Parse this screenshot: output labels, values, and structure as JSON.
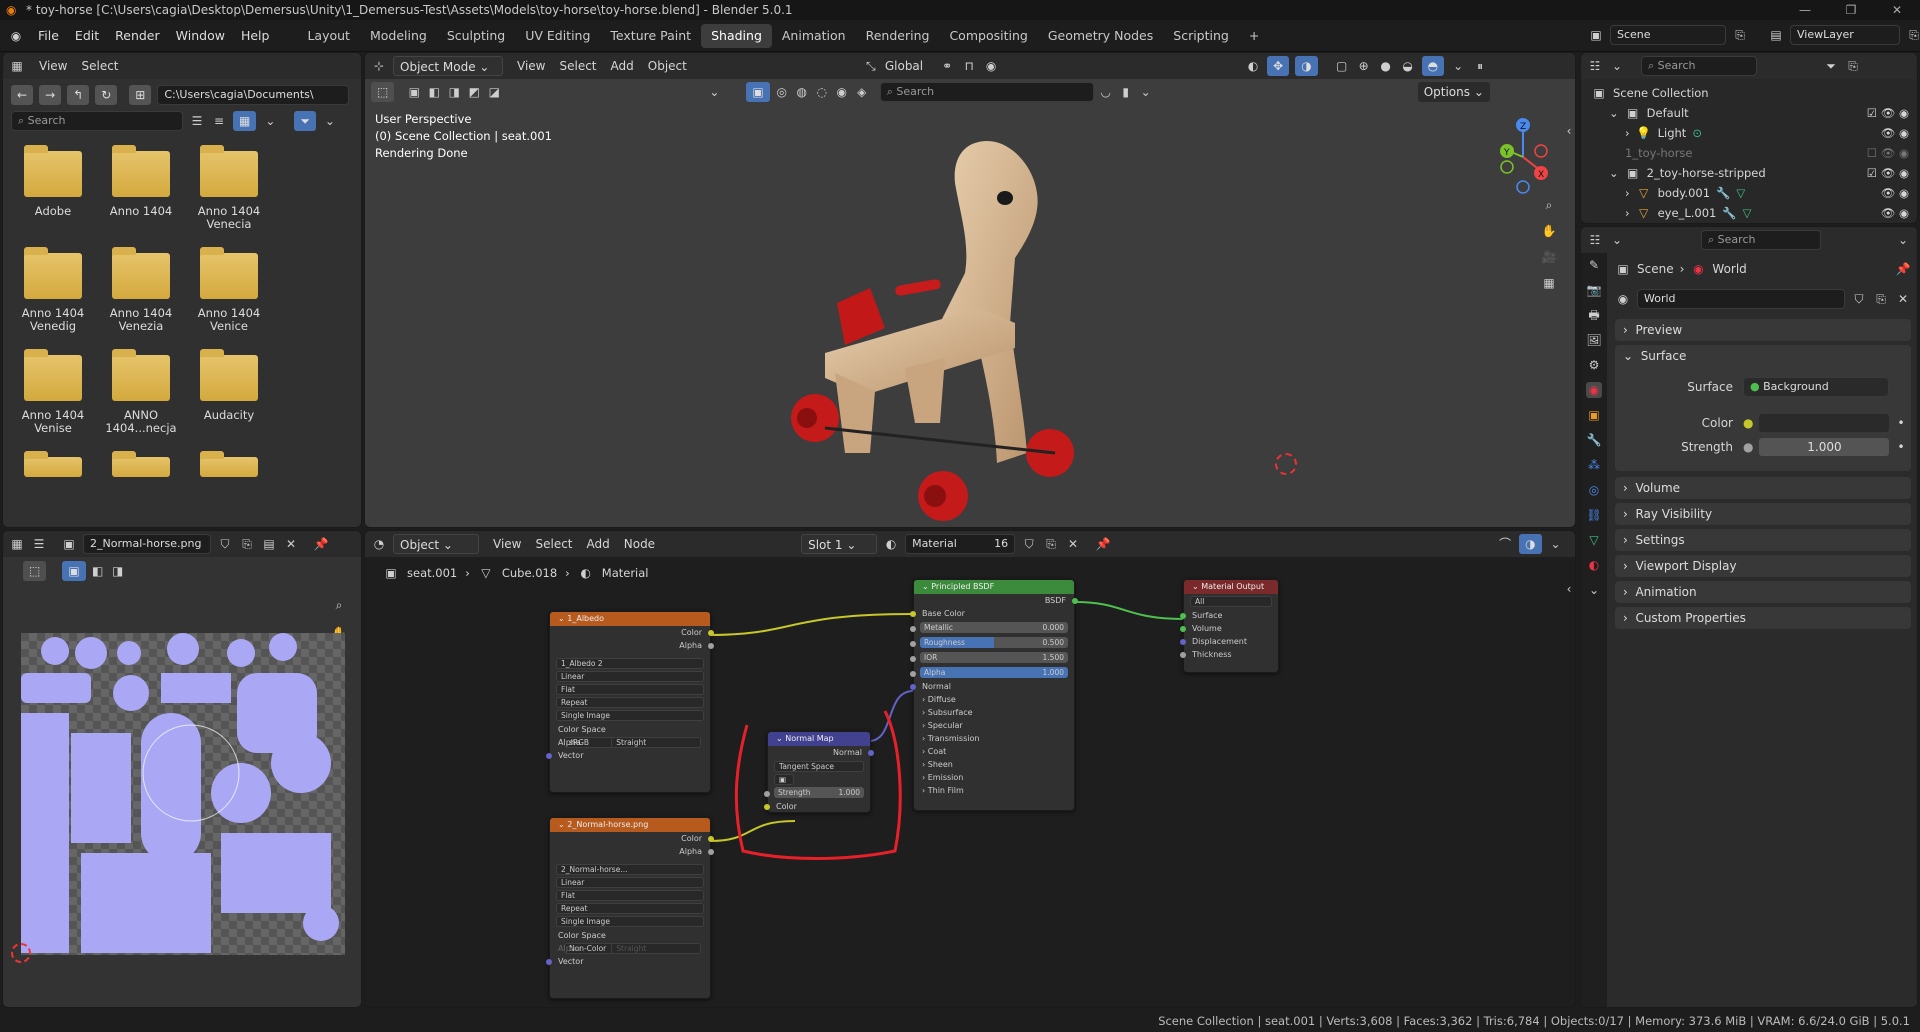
{
  "title": "* toy-horse [C:\\Users\\cagia\\Desktop\\Demersus\\Unity\\1_Demersus-Test\\Assets\\Models\\toy-horse\\toy-horse.blend] - Blender 5.0.1",
  "menu": [
    "File",
    "Edit",
    "Render",
    "Window",
    "Help"
  ],
  "workspaces": [
    "Layout",
    "Modeling",
    "Sculpting",
    "UV Editing",
    "Texture Paint",
    "Shading",
    "Animation",
    "Rendering",
    "Compositing",
    "Geometry Nodes",
    "Scripting"
  ],
  "active_workspace": "Shading",
  "scene_label": "Scene",
  "viewlayer_label": "ViewLayer",
  "filebrowser": {
    "menu": [
      "View",
      "Select"
    ],
    "path": "C:\\Users\\cagia\\Documents\\",
    "search_placeholder": "Search",
    "folders": [
      "Adobe",
      "Anno 1404",
      "Anno 1404 Venecia",
      "Anno 1404 Venedig",
      "Anno 1404 Venezia",
      "Anno 1404 Venice",
      "Anno 1404 Venise",
      "ANNO 1404...necja",
      "Audacity"
    ]
  },
  "viewport": {
    "mode": "Object Mode",
    "menu": [
      "View",
      "Select",
      "Add",
      "Object"
    ],
    "transform": "Global",
    "search_placeholder": "Search",
    "options": "Options",
    "info": [
      "User Perspective",
      "(0) Scene Collection | seat.001",
      "Rendering Done"
    ]
  },
  "image_editor": {
    "image_name": "2_Normal-horse.png"
  },
  "node_editor": {
    "mode": "Object",
    "menu": [
      "View",
      "Select",
      "Add",
      "Node"
    ],
    "slot": "Slot 1",
    "material": "Material",
    "users": "16",
    "breadcrumb": [
      "seat.001",
      "Cube.018",
      "Material"
    ],
    "nodes": {
      "albedo": {
        "title": "1_Albedo",
        "out": [
          "Color",
          "Alpha"
        ],
        "img": "1_Albedo",
        "users": "2",
        "interp": "Linear",
        "proj": "Flat",
        "ext": "Repeat",
        "src": "Single Image",
        "cs_label": "Color Space",
        "cs": "sRGB",
        "alpha_label": "Alpha",
        "alpha": "Straight",
        "in": "Vector"
      },
      "normal_img": {
        "title": "2_Normal-horse.png",
        "out": [
          "Color",
          "Alpha"
        ],
        "img": "2_Normal-horse...",
        "interp": "Linear",
        "proj": "Flat",
        "ext": "Repeat",
        "src": "Single Image",
        "cs_label": "Color Space",
        "cs": "Non-Color",
        "alpha_label": "Alpha",
        "alpha": "Straight",
        "in": "Vector"
      },
      "normal_map": {
        "title": "Normal Map",
        "out": "Normal",
        "space": "Tangent Space",
        "strength_label": "Strength",
        "strength": "1.000",
        "in": "Color"
      },
      "bsdf": {
        "title": "Principled BSDF",
        "out": "BSDF",
        "base": "Base Color",
        "fields": [
          [
            "Metallic",
            "0.000"
          ],
          [
            "Roughness",
            "0.500"
          ],
          [
            "IOR",
            "1.500"
          ],
          [
            "Alpha",
            "1.000"
          ]
        ],
        "normal": "Normal",
        "panels": [
          "Diffuse",
          "Subsurface",
          "Specular",
          "Transmission",
          "Coat",
          "Sheen",
          "Emission",
          "Thin Film"
        ]
      },
      "output": {
        "title": "Material Output",
        "target": "All",
        "in": [
          "Surface",
          "Volume",
          "Displacement",
          "Thickness"
        ]
      }
    }
  },
  "outliner": {
    "search_placeholder": "Search",
    "root": "Scene Collection",
    "items": [
      {
        "label": "Default",
        "indent": 1
      },
      {
        "label": "Light",
        "indent": 2
      },
      {
        "label": "1_toy-horse",
        "indent": 1,
        "dim": true
      },
      {
        "label": "2_toy-horse-stripped",
        "indent": 1
      },
      {
        "label": "body.001",
        "indent": 2
      },
      {
        "label": "eye_L.001",
        "indent": 2
      }
    ]
  },
  "properties": {
    "search_placeholder": "Search",
    "breadcrumb": [
      "Scene",
      "World"
    ],
    "world_name": "World",
    "sections": [
      "Preview",
      "Surface"
    ],
    "surface_label": "Surface",
    "surface_value": "Background",
    "color_label": "Color",
    "strength_label": "Strength",
    "strength_value": "1.000",
    "more_sections": [
      "Volume",
      "Ray Visibility",
      "Settings",
      "Viewport Display",
      "Animation",
      "Custom Properties"
    ]
  },
  "status": "Scene Collection | seat.001 | Verts:3,608 | Faces:3,362 | Tris:6,784 | Objects:0/17 | Memory: 373.6 MiB | VRAM: 6.6/24.0 GiB | 5.0.1",
  "colors": {
    "accent": "#4772b3",
    "annotation": "#e8202a",
    "image_node": "#b65a1e",
    "shader_node": "#3c8a3c",
    "vector_node": "#42418f",
    "output_node": "#7a2a2a"
  }
}
